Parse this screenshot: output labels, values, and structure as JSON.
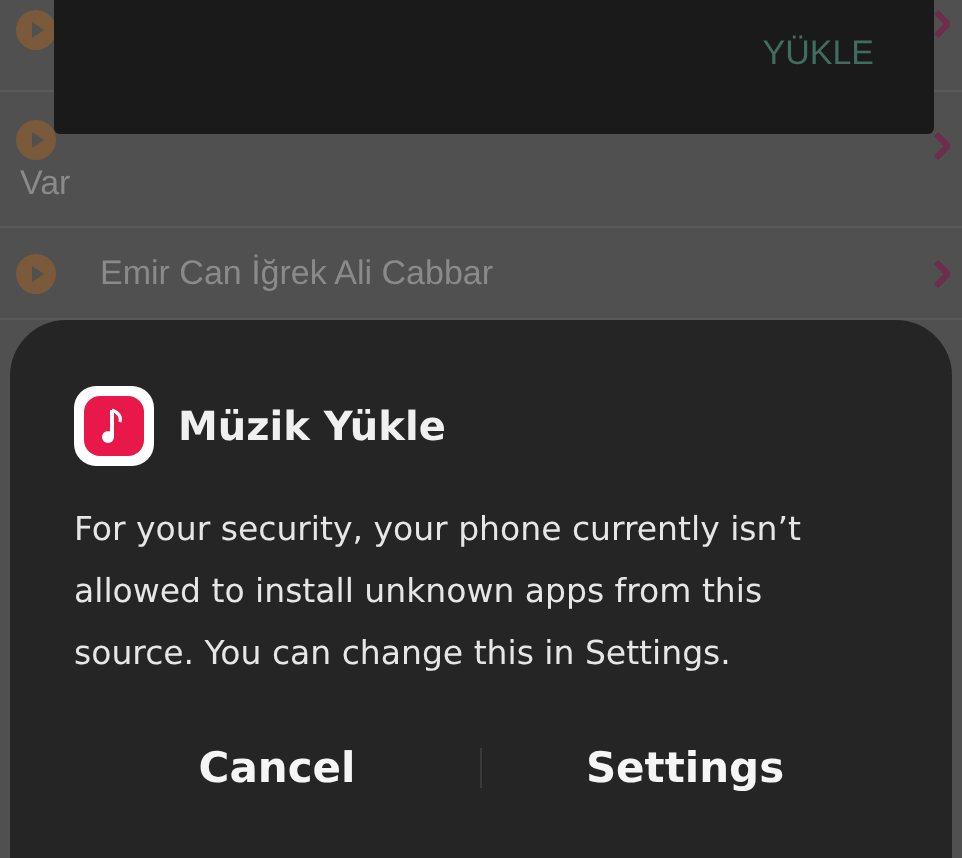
{
  "song_list": [
    {
      "kind": "covered"
    },
    {
      "kind": "wrapped",
      "text": "Var"
    },
    {
      "kind": "plain",
      "text": "Emir Can İğrek Ali Cabbar"
    }
  ],
  "snackbar": {
    "action": "YÜKLE"
  },
  "dialog": {
    "title": "Müzik Yükle",
    "message": "For your security, your phone currently isn’t allowed to install unknown apps from this source. You can change this in Settings.",
    "buttons": [
      "Cancel",
      "Settings"
    ]
  }
}
